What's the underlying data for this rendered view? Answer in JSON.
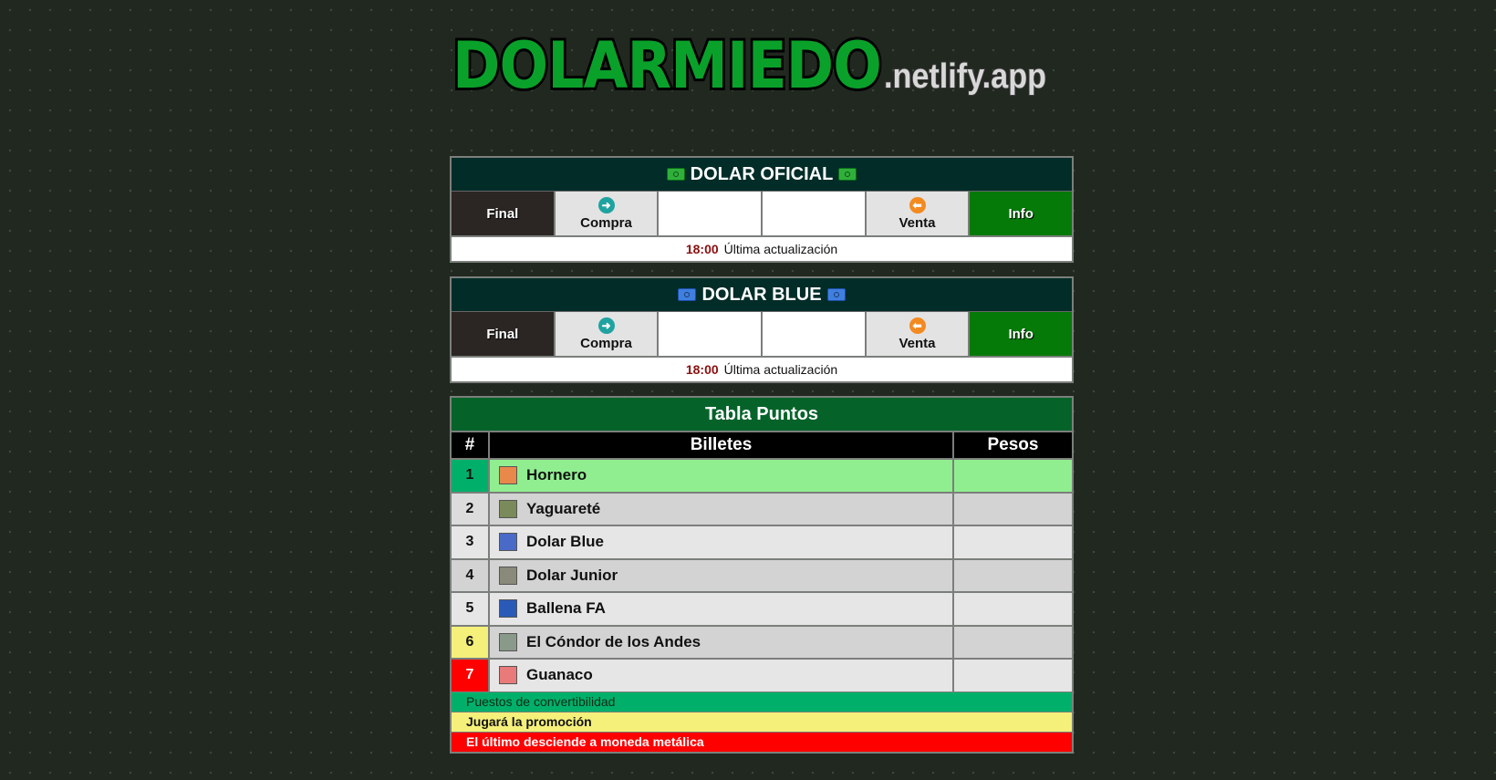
{
  "logo": {
    "main": "DOLARMIEDO",
    "suffix": ".netlify.app"
  },
  "colors": {
    "accent_green": "#0aa12a",
    "convertibility": "#00b06a",
    "promotion": "#f4f07a",
    "descend": "#ff0000",
    "time_red": "#8a0f0f"
  },
  "oficial": {
    "title": "DOLAR OFICIAL",
    "icon": "green-bill-icon",
    "final_label": "Final",
    "compra_label": "Compra",
    "compra_value": "",
    "venta_value": "",
    "venta_label": "Venta",
    "info_label": "Info",
    "time": "18:00",
    "update_label": "Última actualización"
  },
  "blue": {
    "title": "DOLAR BLUE",
    "icon": "blue-bill-icon",
    "final_label": "Final",
    "compra_label": "Compra",
    "compra_value": "",
    "venta_value": "",
    "venta_label": "Venta",
    "info_label": "Info",
    "time": "18:00",
    "update_label": "Última actualización"
  },
  "table": {
    "title": "Tabla Puntos",
    "headers": {
      "rank": "#",
      "billetes": "Billetes",
      "pesos": "Pesos"
    },
    "rows": [
      {
        "rank": "1",
        "name": "Hornero",
        "pesos": "",
        "rank_bg": "#00b06a",
        "row_bg": "#90ee90",
        "thumb": "#e8884a",
        "icon": "hornero-bill-icon"
      },
      {
        "rank": "2",
        "name": "Yaguareté",
        "pesos": "",
        "rank_bg": "#dcdcdc",
        "row_bg": "#d3d3d3",
        "thumb": "#7a8a5a",
        "icon": "yaguarete-bill-icon"
      },
      {
        "rank": "3",
        "name": "Dolar Blue",
        "pesos": "",
        "rank_bg": "#e6e6e6",
        "row_bg": "#e6e6e6",
        "thumb": "#4a6ac8",
        "icon": "dolar-blue-bill-icon"
      },
      {
        "rank": "4",
        "name": "Dolar Junior",
        "pesos": "",
        "rank_bg": "#d3d3d3",
        "row_bg": "#d3d3d3",
        "thumb": "#8a8a7a",
        "icon": "dolar-junior-bill-icon"
      },
      {
        "rank": "5",
        "name": "Ballena FA",
        "pesos": "",
        "rank_bg": "#e6e6e6",
        "row_bg": "#e6e6e6",
        "thumb": "#2a5ab8",
        "icon": "ballena-bill-icon"
      },
      {
        "rank": "6",
        "name": "El Cóndor de los Andes",
        "pesos": "",
        "rank_bg": "#f4f07a",
        "row_bg": "#d3d3d3",
        "thumb": "#8a9a8a",
        "icon": "condor-bill-icon"
      },
      {
        "rank": "7",
        "name": "Guanaco",
        "pesos": "",
        "rank_bg": "#ff0000",
        "row_bg": "#e6e6e6",
        "thumb": "#e87a7a",
        "icon": "guanaco-bill-icon"
      }
    ],
    "legend": {
      "convertibility": "Puestos de convertibilidad",
      "promotion": "Jugará la promoción",
      "descend": "El último desciende a moneda metálica"
    }
  }
}
